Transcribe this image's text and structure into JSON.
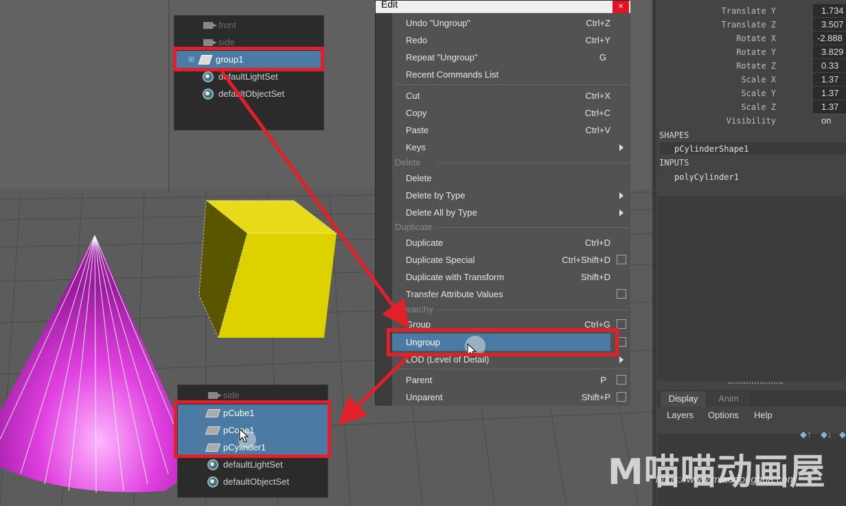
{
  "outliner_top": {
    "items": [
      {
        "label": "front",
        "icon": "camera-icon",
        "dim": true
      },
      {
        "label": "side",
        "icon": "camera-icon",
        "dim": true
      },
      {
        "label": "group1",
        "icon": "group-icon",
        "selected": true
      },
      {
        "label": "defaultLightSet",
        "icon": "set-icon"
      },
      {
        "label": "defaultObjectSet",
        "icon": "set-icon"
      }
    ]
  },
  "outliner_bottom": {
    "items": [
      {
        "label": "side",
        "icon": "camera-icon",
        "dim": true
      },
      {
        "label": "pCube1",
        "icon": "mesh-icon",
        "selected": true
      },
      {
        "label": "pCone1",
        "icon": "mesh-icon",
        "selected": true
      },
      {
        "label": "pCylinder1",
        "icon": "mesh-icon",
        "selected": true
      },
      {
        "label": "defaultLightSet",
        "icon": "set-icon"
      },
      {
        "label": "defaultObjectSet",
        "icon": "set-icon"
      }
    ]
  },
  "menu": {
    "title": "Edit",
    "close": "×",
    "items": {
      "undo": {
        "label": "Undo \"Ungroup\"",
        "shortcut": "Ctrl+Z"
      },
      "redo": {
        "label": "Redo",
        "shortcut": "Ctrl+Y"
      },
      "repeat": {
        "label": "Repeat \"Ungroup\"",
        "shortcut": "G"
      },
      "recent": {
        "label": "Recent Commands List"
      },
      "cut": {
        "label": "Cut",
        "shortcut": "Ctrl+X"
      },
      "copy": {
        "label": "Copy",
        "shortcut": "Ctrl+C"
      },
      "paste": {
        "label": "Paste",
        "shortcut": "Ctrl+V"
      },
      "keys": {
        "label": "Keys"
      },
      "sec_delete": "Delete",
      "delete": {
        "label": "Delete"
      },
      "delete_by_type": {
        "label": "Delete by Type"
      },
      "delete_all_by_type": {
        "label": "Delete All by Type"
      },
      "sec_duplicate": "Duplicate",
      "duplicate": {
        "label": "Duplicate",
        "shortcut": "Ctrl+D"
      },
      "duplicate_special": {
        "label": "Duplicate Special",
        "shortcut": "Ctrl+Shift+D"
      },
      "duplicate_with_transform": {
        "label": "Duplicate with Transform",
        "shortcut": "Shift+D"
      },
      "transfer_attr": {
        "label": "Transfer Attribute Values"
      },
      "sec_hierarchy": "Hierarchy",
      "group": {
        "label": "Group",
        "shortcut": "Ctrl+G"
      },
      "ungroup": {
        "label": "Ungroup"
      },
      "lod": {
        "label": "LOD (Level of Detail)"
      },
      "parent": {
        "label": "Parent",
        "shortcut": "P"
      },
      "unparent": {
        "label": "Unparent",
        "shortcut": "Shift+P"
      }
    }
  },
  "channel_box": {
    "attributes": [
      {
        "label": "Translate Y",
        "value": "1.734"
      },
      {
        "label": "Translate Z",
        "value": "3.507"
      },
      {
        "label": "Rotate X",
        "value": "-2.888"
      },
      {
        "label": "Rotate Y",
        "value": "3.829"
      },
      {
        "label": "Rotate Z",
        "value": "0.33"
      },
      {
        "label": "Scale X",
        "value": "1.37"
      },
      {
        "label": "Scale Y",
        "value": "1.37"
      },
      {
        "label": "Scale Z",
        "value": "1.37"
      },
      {
        "label": "Visibility",
        "value": "on"
      }
    ],
    "shapes_title": "SHAPES",
    "shape_item": "pCylinderShape1",
    "inputs_title": "INPUTS",
    "input_item": "polyCylinder1"
  },
  "layer_editor": {
    "tabs": [
      "Display",
      "Anim"
    ],
    "menus": [
      "Layers",
      "Options",
      "Help"
    ]
  },
  "watermark": {
    "brand": "M喵喵动画屋",
    "url": "https://www.miaodonghua.com"
  },
  "colors": {
    "selection": "#4b7ba4",
    "highlight_box": "#e32027",
    "cube": "#e0d400",
    "cone": "#e040e0"
  }
}
